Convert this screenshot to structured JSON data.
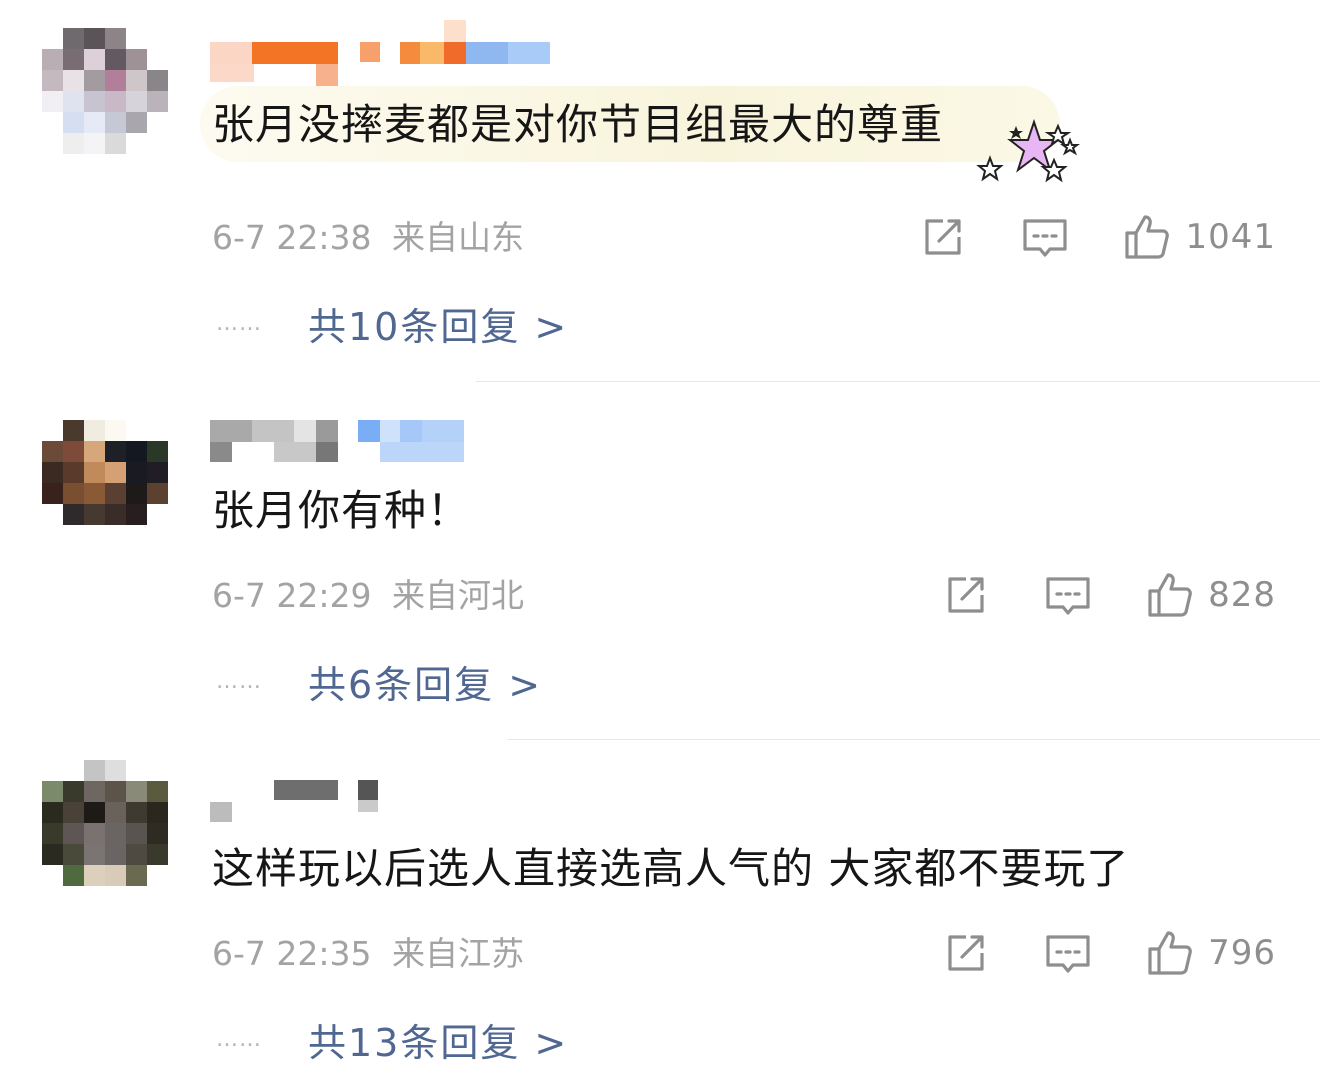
{
  "comments": [
    {
      "text": "张月没摔麦都是对你节目组最大的尊重",
      "time": "6-7 22:38",
      "location": "来自山东",
      "likes": "1041",
      "replies": "共10条回复 >",
      "dots": "……",
      "highlighted": true
    },
    {
      "text": "张月你有种！",
      "time": "6-7 22:29",
      "location": "来自河北",
      "likes": "828",
      "replies": "共6条回复 >",
      "dots": "……"
    },
    {
      "text": "这样玩以后选人直接选高人气的  大家都不要玩了",
      "time": "6-7 22:35",
      "location": "来自江苏",
      "likes": "796",
      "replies": "共13条回复 >",
      "dots": "……"
    }
  ],
  "icons": {
    "share": "share-icon",
    "comment": "comment-icon",
    "like": "thumbs-up-icon"
  },
  "colors": {
    "reply_link": "#4f6791",
    "meta_text": "#a3a3a3",
    "body_text": "#161616"
  }
}
